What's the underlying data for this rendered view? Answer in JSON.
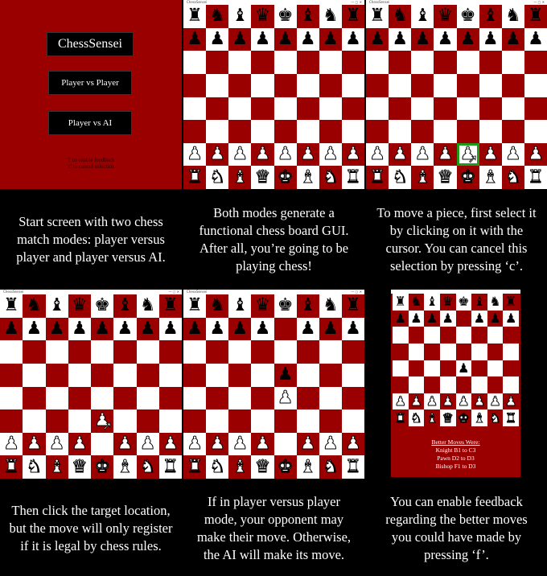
{
  "colors": {
    "dark_square": "#9b0000",
    "light_square": "#ffffff",
    "background": "#000000",
    "selection": "#1f9a1f"
  },
  "start_screen": {
    "title": "ChessSensei",
    "button_pvp": "Player vs Player",
    "button_pva": "Player vs AI",
    "note_line1": "'f' to enable feedback",
    "note_line2": "'c' to cancel selection"
  },
  "window": {
    "title": "ChessSensei",
    "controls": "— ▢ ✕"
  },
  "captions": [
    "Start screen with two chess match modes: player versus player and player versus AI.",
    "Both modes generate a functional chess board GUI. After all, you’re going to be playing chess!",
    "To move a piece, first select it by clicking on it with the cursor. You can cancel this selection by pressing ‘c’.",
    "Then click the target location, but the move will only register if it is legal by chess rules.",
    "If in player versus player mode, your opponent may make their move. Otherwise, the AI will make its move.",
    "You can enable feedback regarding the better moves you could have made by pressing ‘f’."
  ],
  "feedback": {
    "title": "Better Moves Were:",
    "moves": [
      "Knight B1 to C3",
      "Pawn D2 to D3",
      "Bishop F1 to D3"
    ]
  },
  "boards": {
    "initial": [
      "rnbqkbnr",
      "pppppppp",
      "........",
      "........",
      "........",
      "........",
      "PPPPPPPP",
      "RNBQKBNR"
    ],
    "selected": [
      "rnbqkbnr",
      "pppppppp",
      "........",
      "........",
      "........",
      "........",
      "PPPPPPPP",
      "RNBQKBNR"
    ],
    "moved": [
      "rnbqkbnr",
      "pppppppp",
      "........",
      "........",
      "........",
      "....P...",
      "PPPP.PPP",
      "RNBQKBNR"
    ],
    "ai_reply": [
      "rnbqkbnr",
      "pppp.ppp",
      "........",
      "....p...",
      "....P...",
      "........",
      "PPPP.PPP",
      "RNBQKBNR"
    ],
    "feedback": [
      "rnbqkbnr",
      "pppp.ppp",
      "........",
      "........",
      "....p...",
      "........",
      "PPPPPPPP",
      "RNBQKBNR"
    ]
  }
}
